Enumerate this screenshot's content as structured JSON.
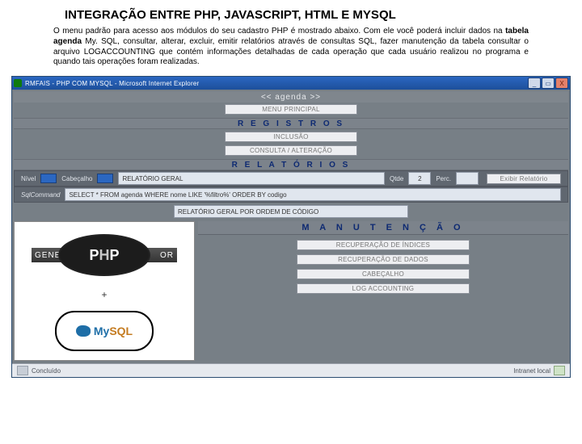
{
  "document": {
    "title": "INTEGRAÇÃO ENTRE PHP, JAVASCRIPT, HTML E MYSQL",
    "paragraph_plain_bold_table_name": "tabela agenda",
    "paragraph_before": "O menu padrão para acesso aos módulos do seu cadastro PHP é mostrado abaixo. Com ele você poderá incluir dados na ",
    "paragraph_after": " My. SQL, consultar, alterar, excluir, emitir relatórios através de consultas SQL, fazer manutenção da tabela consultar o arquivo LOGACCOUNTING que contém informações detalhadas de cada operação que cada usuário realizou no programa e quando tais operações foram realizadas."
  },
  "browser": {
    "title": "RMFAIS - PHP COM MYSQL - Microsoft Internet Explorer",
    "window_buttons": {
      "minimize": "_",
      "maximize": "▭",
      "close": "X"
    },
    "status_left": "Concluído",
    "status_right": "Intranet local"
  },
  "header": {
    "banner": "<< agenda >>",
    "main_menu_button": "MENU PRINCIPAL"
  },
  "registros": {
    "section_title": "R E G I S T R O S",
    "include_button": "INCLUSÃO",
    "query_button": "CONSULTA / ALTERAÇÃO"
  },
  "relatorios": {
    "section_title": "R E L A T Ó R I O S",
    "row1": {
      "lbl1": "Nível",
      "lbl2": "Cabeçalho",
      "report_select": "RELATÓRIO GERAL",
      "qty_label": "Qtde",
      "qty_value": "2",
      "perc_label": "Perc.",
      "perc_value": "",
      "show_button": "Exibir Relatório"
    },
    "row2": {
      "lbl": "SqlCommand",
      "value": "SELECT * FROM agenda WHERE nome LIKE '%filtro%' ORDER BY codigo"
    },
    "row3": {
      "select_value": "RELATÓRIO GERAL POR ORDEM DE CÓDIGO"
    }
  },
  "manutencao": {
    "section_title": "M A N U T E N Ç Ã O",
    "buttons": [
      "RECUPERAÇÃO DE ÍNDICES",
      "RECUPERAÇÃO DE DADOS",
      "CABEÇALHO",
      "LOG ACCOUNTING"
    ]
  },
  "logos": {
    "php_generator_left": "GENERA",
    "php_generator_right": "OR",
    "plus": "+",
    "mysql": "MySQL"
  }
}
